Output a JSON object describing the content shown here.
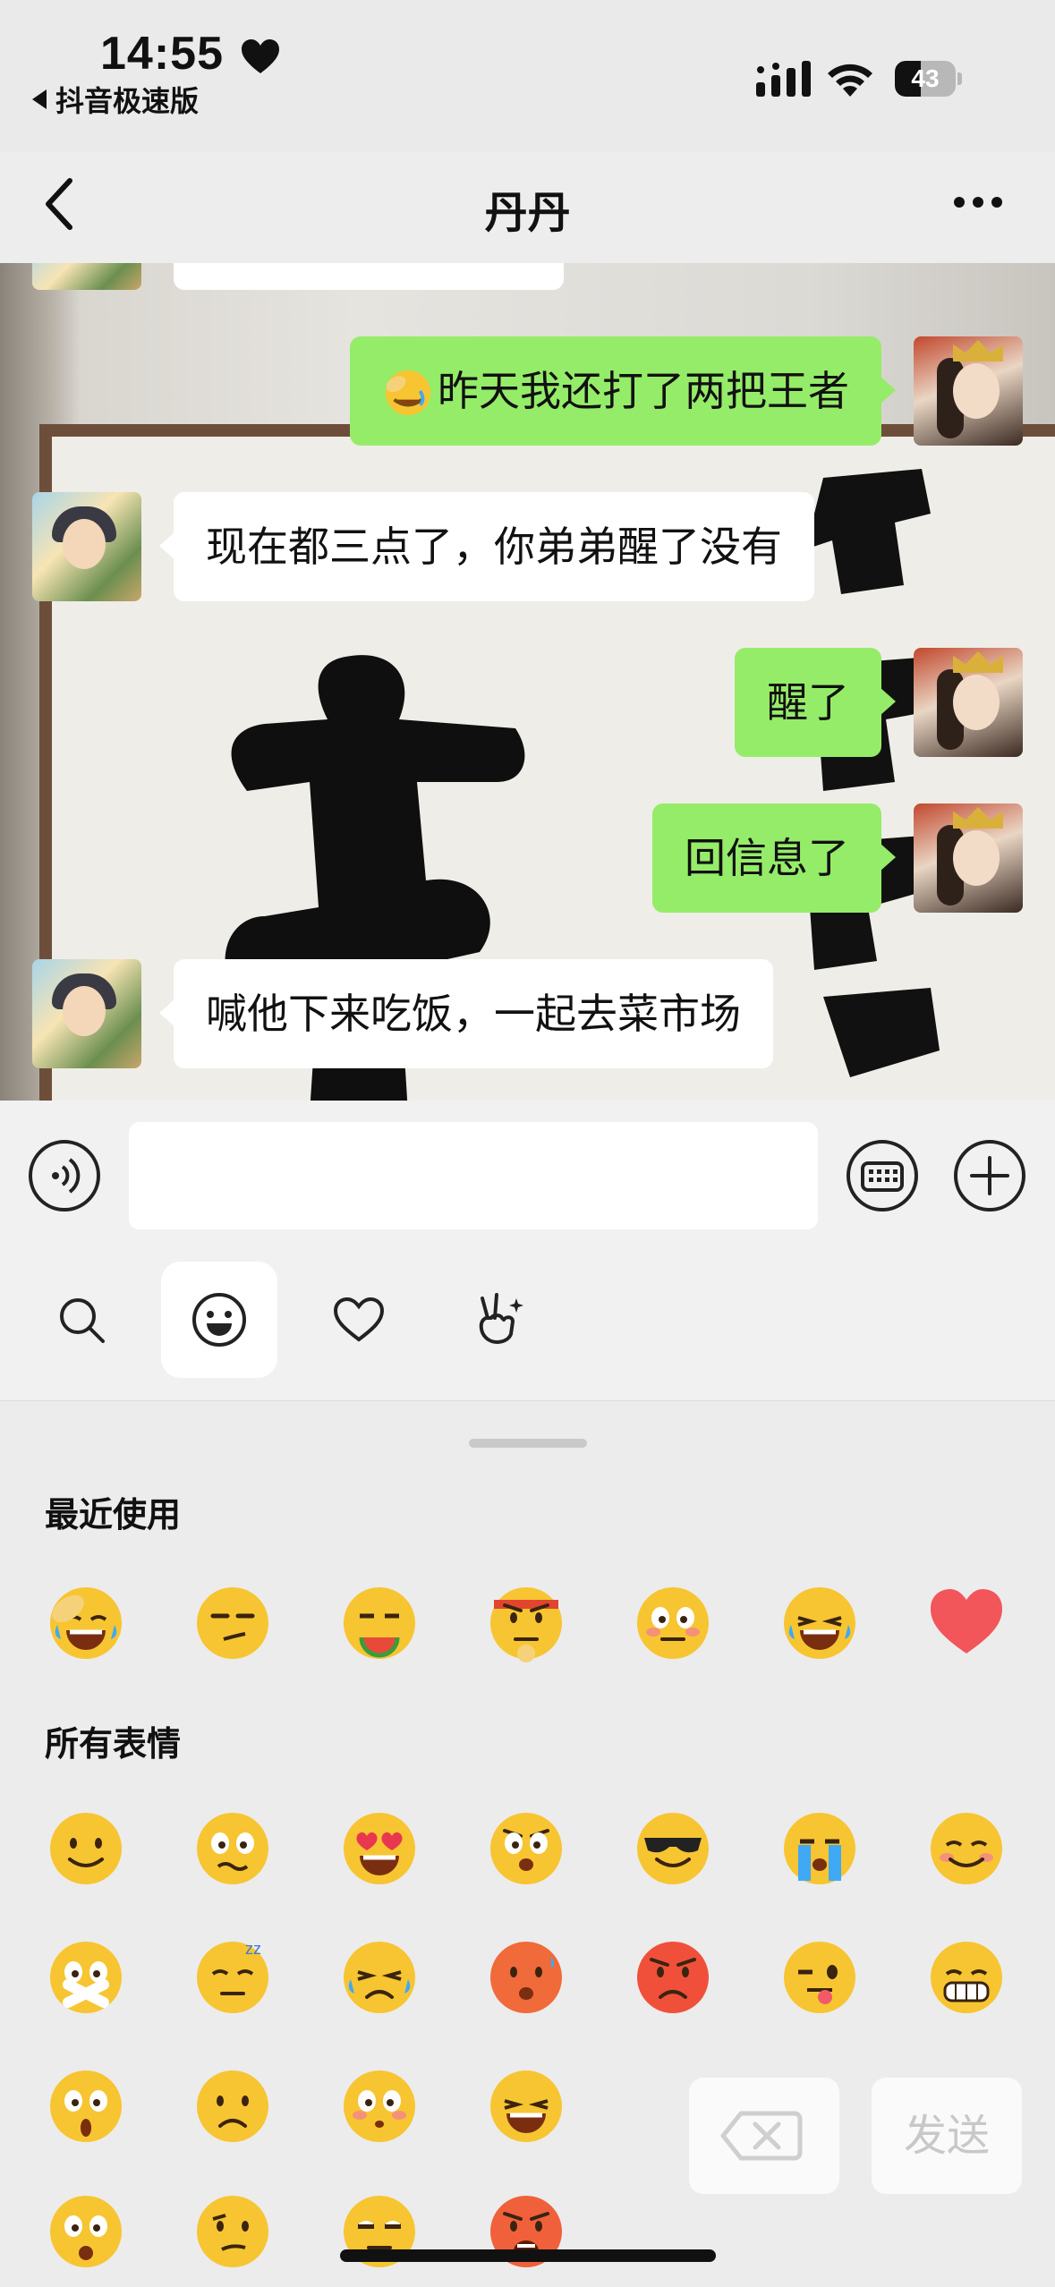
{
  "status_bar": {
    "time": "14:55",
    "back_app": "抖音极速版",
    "battery_level": "43",
    "battery_fraction": 0.43,
    "icons": [
      "heart-icon",
      "cellular-signal-icon",
      "wifi-icon",
      "battery-icon"
    ]
  },
  "nav": {
    "title": "丹丹",
    "icons": [
      "back-chevron-icon",
      "more-dots-icon"
    ]
  },
  "messages": [
    {
      "side": "right",
      "text": "昨天我还打了两把王者",
      "emoji": "face-palm-laugh"
    },
    {
      "side": "left",
      "text": "现在都三点了，你弟弟醒了没有"
    },
    {
      "side": "right",
      "text": "醒了"
    },
    {
      "side": "right",
      "text": "回信息了"
    },
    {
      "side": "left",
      "text": "喊他下来吃饭，一起去菜市场"
    }
  ],
  "input_bar": {
    "value": "",
    "icons": [
      "voice-icon",
      "keyboard-icon",
      "plus-icon"
    ]
  },
  "tool_tabs": [
    {
      "name": "search",
      "active": false
    },
    {
      "name": "emoji",
      "active": true
    },
    {
      "name": "favorites",
      "active": false
    },
    {
      "name": "sticker",
      "active": false
    }
  ],
  "emoji_panel": {
    "recent_title": "最近使用",
    "all_title": "所有表情",
    "recent": [
      "facepalm",
      "smirk",
      "eat-watermelon",
      "headband-thinking",
      "flushed",
      "tears-of-joy",
      "red-heart"
    ],
    "all": [
      [
        "smile",
        "worried",
        "heart-eyes",
        "angry-stare",
        "cool",
        "cry-loudly",
        "shy"
      ],
      [
        "shush",
        "sleepy",
        "tears-squint",
        "embarrassed",
        "furious",
        "wink-tongue",
        "grin"
      ],
      [
        "surprised",
        "sad",
        "flushed-small",
        "laugh-squint"
      ],
      [
        "shocked",
        "confused",
        "bored",
        "shout"
      ]
    ],
    "delete_icon": "backspace-icon",
    "send_label": "发送"
  },
  "colors": {
    "bubble_right": "#95ec69",
    "bubble_left": "#ffffff",
    "page_bg": "#ededed",
    "emoji_yellow": "#f7c531"
  }
}
